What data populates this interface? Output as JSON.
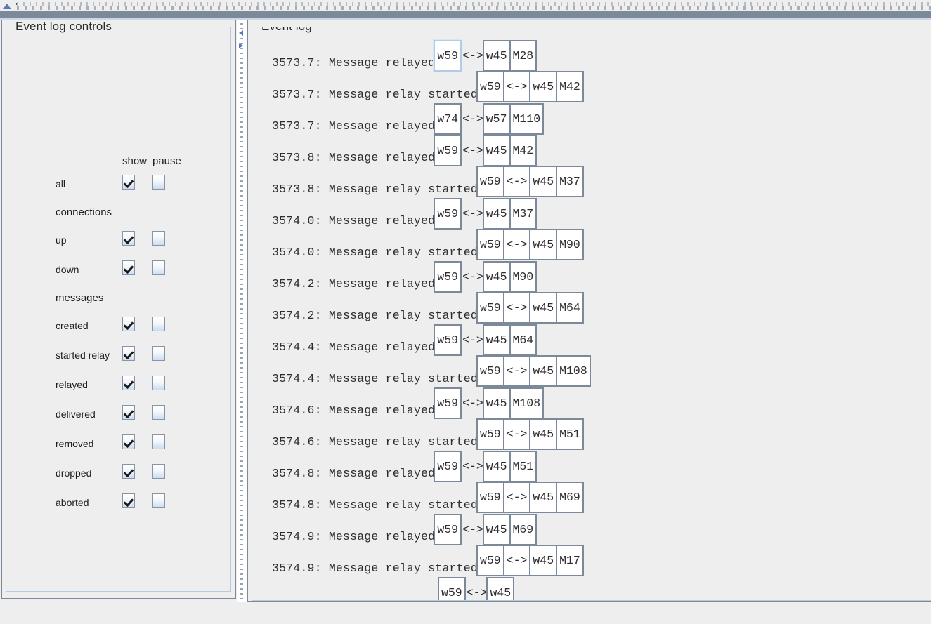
{
  "toolbar": {
    "icons": [
      "cone-icon",
      "funnel-icon"
    ]
  },
  "left_panel": {
    "title": "Event log controls",
    "columns": {
      "show": "show",
      "pause": "pause"
    },
    "rows": [
      {
        "type": "item",
        "label": "all",
        "show": true,
        "pause": false
      },
      {
        "type": "section",
        "label": "connections"
      },
      {
        "type": "item",
        "label": "up",
        "show": true,
        "pause": false
      },
      {
        "type": "item",
        "label": "down",
        "show": true,
        "pause": false
      },
      {
        "type": "section",
        "label": "messages"
      },
      {
        "type": "item",
        "label": "created",
        "show": true,
        "pause": false
      },
      {
        "type": "item",
        "label": "started relay",
        "show": true,
        "pause": false
      },
      {
        "type": "item",
        "label": "relayed",
        "show": true,
        "pause": false
      },
      {
        "type": "item",
        "label": "delivered",
        "show": true,
        "pause": false
      },
      {
        "type": "item",
        "label": "removed",
        "show": true,
        "pause": false
      },
      {
        "type": "item",
        "label": "dropped",
        "show": true,
        "pause": false
      },
      {
        "type": "item",
        "label": "aborted",
        "show": true,
        "pause": false
      }
    ]
  },
  "right_panel": {
    "title": "Event log",
    "entries": [
      {
        "time": "3573.7:",
        "message": "Message relayed",
        "src": "w59",
        "arrow": "<->",
        "dst": "w45",
        "msg": "M28",
        "arrow_boxed": false,
        "selected": true
      },
      {
        "time": "3573.7:",
        "message": "Message relay started",
        "src": "w59",
        "arrow": "<->",
        "dst": "w45",
        "msg": "M42",
        "arrow_boxed": true,
        "selected": false
      },
      {
        "time": "3573.7:",
        "message": "Message relayed",
        "src": "w74",
        "arrow": "<->",
        "dst": "w57",
        "msg": "M110",
        "arrow_boxed": false,
        "selected": false
      },
      {
        "time": "3573.8:",
        "message": "Message relayed",
        "src": "w59",
        "arrow": "<->",
        "dst": "w45",
        "msg": "M42",
        "arrow_boxed": false,
        "selected": false
      },
      {
        "time": "3573.8:",
        "message": "Message relay started",
        "src": "w59",
        "arrow": "<->",
        "dst": "w45",
        "msg": "M37",
        "arrow_boxed": true,
        "selected": false
      },
      {
        "time": "3574.0:",
        "message": "Message relayed",
        "src": "w59",
        "arrow": "<->",
        "dst": "w45",
        "msg": "M37",
        "arrow_boxed": false,
        "selected": false
      },
      {
        "time": "3574.0:",
        "message": "Message relay started",
        "src": "w59",
        "arrow": "<->",
        "dst": "w45",
        "msg": "M90",
        "arrow_boxed": true,
        "selected": false
      },
      {
        "time": "3574.2:",
        "message": "Message relayed",
        "src": "w59",
        "arrow": "<->",
        "dst": "w45",
        "msg": "M90",
        "arrow_boxed": false,
        "selected": false
      },
      {
        "time": "3574.2:",
        "message": "Message relay started",
        "src": "w59",
        "arrow": "<->",
        "dst": "w45",
        "msg": "M64",
        "arrow_boxed": true,
        "selected": false
      },
      {
        "time": "3574.4:",
        "message": "Message relayed",
        "src": "w59",
        "arrow": "<->",
        "dst": "w45",
        "msg": "M64",
        "arrow_boxed": false,
        "selected": false
      },
      {
        "time": "3574.4:",
        "message": "Message relay started",
        "src": "w59",
        "arrow": "<->",
        "dst": "w45",
        "msg": "M108",
        "arrow_boxed": true,
        "selected": false
      },
      {
        "time": "3574.6:",
        "message": "Message relayed",
        "src": "w59",
        "arrow": "<->",
        "dst": "w45",
        "msg": "M108",
        "arrow_boxed": false,
        "selected": false
      },
      {
        "time": "3574.6:",
        "message": "Message relay started",
        "src": "w59",
        "arrow": "<->",
        "dst": "w45",
        "msg": "M51",
        "arrow_boxed": true,
        "selected": false
      },
      {
        "time": "3574.8:",
        "message": "Message relayed",
        "src": "w59",
        "arrow": "<->",
        "dst": "w45",
        "msg": "M51",
        "arrow_boxed": false,
        "selected": false
      },
      {
        "time": "3574.8:",
        "message": "Message relay started",
        "src": "w59",
        "arrow": "<->",
        "dst": "w45",
        "msg": "M69",
        "arrow_boxed": true,
        "selected": false
      },
      {
        "time": "3574.9:",
        "message": "Message relayed",
        "src": "w59",
        "arrow": "<->",
        "dst": "w45",
        "msg": "M69",
        "arrow_boxed": false,
        "selected": false
      },
      {
        "time": "3574.9:",
        "message": "Message relay started",
        "src": "w59",
        "arrow": "<->",
        "dst": "w45",
        "msg": "M17",
        "arrow_boxed": true,
        "selected": false
      },
      {
        "time": "",
        "message": "",
        "src": "w59",
        "arrow": "<->",
        "dst": "w45",
        "msg": "",
        "arrow_boxed": false,
        "selected": false,
        "clipped": true
      }
    ]
  },
  "colors": {
    "surface": "#eeeeee",
    "frame": "#7c8999",
    "group_border": "#b6cbe2",
    "cell_border": "#7c8999",
    "accent_blue": "#5b78b8",
    "selection": "#b3cbe8"
  }
}
